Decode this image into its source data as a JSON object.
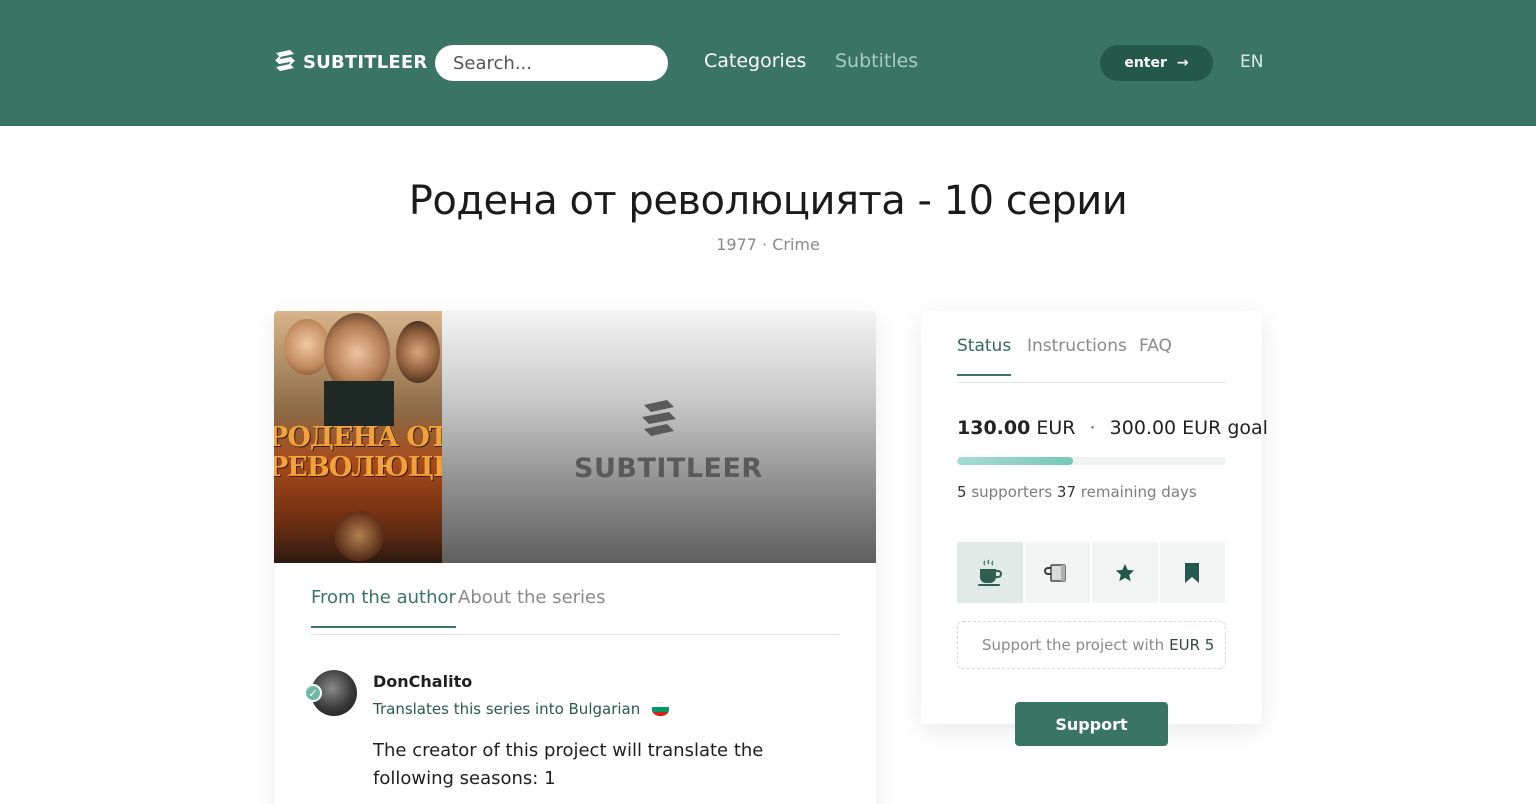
{
  "header": {
    "logo_text": "SUBTITLEER",
    "search_placeholder": "Search...",
    "nav": {
      "categories": "Categories",
      "subtitles": "Subtitles"
    },
    "enter_label": "enter",
    "enter_arrow": "→",
    "language": "EN"
  },
  "project": {
    "title": "Родена от революцията - 10 серии",
    "year": "1977",
    "separator": "·",
    "genre": "Crime"
  },
  "banner": {
    "poster_title_line1": "РОДЕНА ОТ",
    "poster_title_line2": "РЕВОЛЮЦИЯТА",
    "watermark_text": "SUBTITLEER"
  },
  "author_tabs": [
    "From the author",
    "About the series"
  ],
  "author": {
    "name": "DonChalito",
    "subtitle": "Translates this series into Bulgarian",
    "flag_colors": [
      "#ffffff",
      "#00966e",
      "#d62612"
    ],
    "description": "The creator of this project will translate the following seasons: 1"
  },
  "status_tabs": [
    "Status",
    "Instructions",
    "FAQ"
  ],
  "funding": {
    "raised": "130.00",
    "currency": "EUR",
    "goal_text": "300.00 EUR goal",
    "progress_fraction": 0.43,
    "supporters_count": "5",
    "supporters_label": "supporters",
    "days_count": "37",
    "days_label": "remaining days"
  },
  "tiers": [
    {
      "icon": "coffee-cup-icon",
      "active": true
    },
    {
      "icon": "mug-icon",
      "active": false
    },
    {
      "icon": "star-icon",
      "active": false
    },
    {
      "icon": "bookmark-icon",
      "active": false
    }
  ],
  "support": {
    "prompt": "Support the project with",
    "amount": "EUR 5",
    "button_label": "Support"
  },
  "colors": {
    "brand": "#3a7563",
    "brand_dark": "#23584a",
    "progress": "#76c7b5"
  }
}
